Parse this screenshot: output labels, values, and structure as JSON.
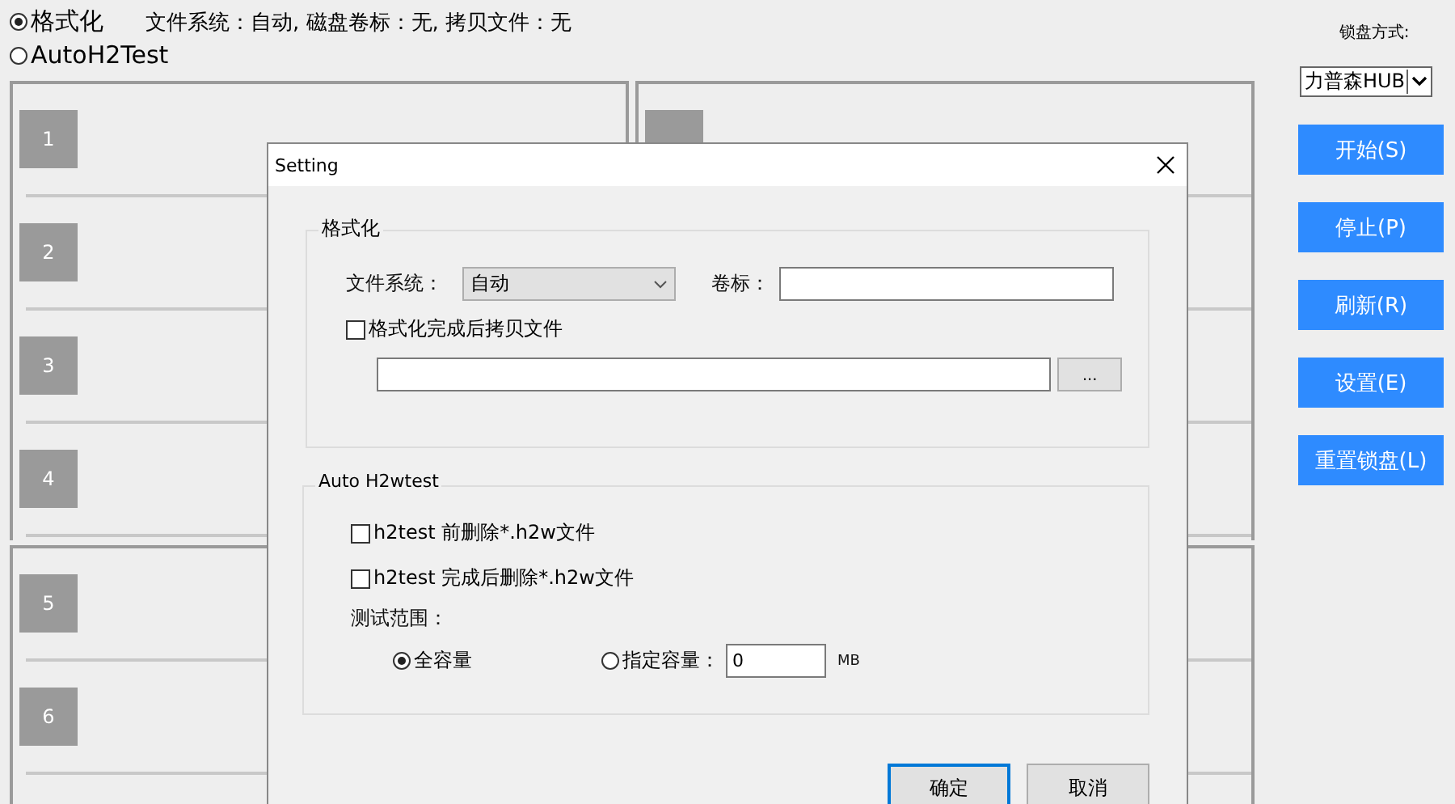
{
  "modes": [
    {
      "label": "格式化",
      "selected": true
    },
    {
      "label": "AutoH2Test",
      "selected": false
    }
  ],
  "status": "文件系统：自动, 磁盘卷标：无, 拷贝文件：无",
  "panels": [
    {
      "rows": [
        {
          "label": "1"
        },
        {
          "label": "2"
        },
        {
          "label": "3"
        },
        {
          "label": "4"
        }
      ]
    },
    {
      "rows": [
        {
          "kind": "tile"
        },
        {
          "kind": "empty"
        },
        {
          "kind": "empty"
        },
        {
          "kind": "empty"
        }
      ]
    },
    {
      "rows": [
        {
          "label": "5"
        },
        {
          "label": "6"
        }
      ]
    },
    {
      "rows": [
        {
          "kind": "empty"
        },
        {
          "kind": "empty"
        }
      ]
    }
  ],
  "sidebar": {
    "lock_label": "锁盘方式:",
    "lock_value": "力普森HUB",
    "buttons": [
      "开始(S)",
      "停止(P)",
      "刷新(R)",
      "设置(E)",
      "重置锁盘(L)"
    ]
  },
  "dialog": {
    "title": "Setting",
    "format_group": {
      "title": "格式化",
      "fs_label": "文件系统：",
      "fs_value": "自动",
      "volume_label": "卷标：",
      "copy": {
        "label": "格式化完成后拷贝文件",
        "checked": false
      },
      "browse": "..."
    },
    "h2_group": {
      "title": "Auto H2wtest",
      "options": [
        {
          "label": "h2test 前删除*.h2w文件",
          "checked": false
        },
        {
          "label": "h2test 完成后删除*.h2w文件",
          "checked": false
        }
      ],
      "range_label": "测试范围：",
      "ranges": [
        {
          "label": "全容量",
          "selected": true
        },
        {
          "label": "指定容量：",
          "selected": false
        }
      ],
      "size_value": "0",
      "unit": "MB"
    },
    "buttons": [
      "确定",
      "取消"
    ]
  }
}
